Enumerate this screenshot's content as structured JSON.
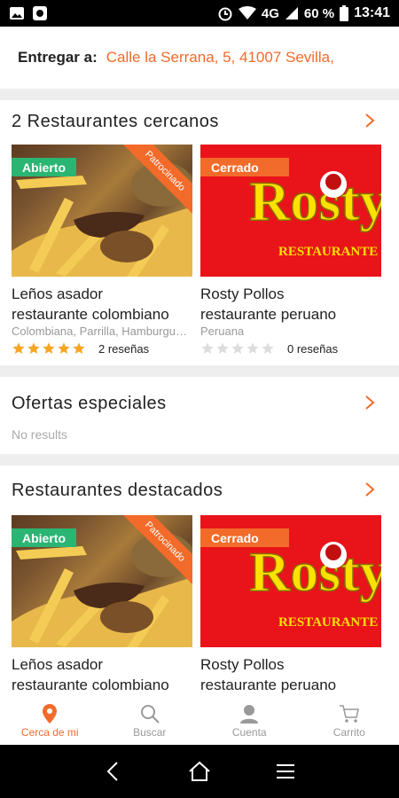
{
  "status_bar": {
    "network": "4G",
    "battery": "60 %",
    "time": "13:41"
  },
  "deliver": {
    "label": "Entregar a:",
    "address": "Calle la Serrana, 5, 41007 Sevilla,"
  },
  "nearby": {
    "title": "2 Restaurantes cercanos",
    "cards": [
      {
        "status": "Abierto",
        "sponsored": "Patrocinado",
        "name_line1": "Leños asador",
        "name_line2": "restaurante colombiano",
        "cuisine": "Colombiana, Parrilla, Hamburguesas",
        "stars": 5,
        "reviews": "2 reseñas"
      },
      {
        "status": "Cerrado",
        "logo_text": "Rosty",
        "logo_subtext": "RESTAURANTE P",
        "name_line1": "Rosty Pollos",
        "name_line2": "restaurante peruano",
        "cuisine": "Peruana",
        "stars": 0,
        "reviews": "0 reseñas"
      }
    ]
  },
  "offers": {
    "title": "Ofertas especiales",
    "empty_text": "No results"
  },
  "featured": {
    "title": "Restaurantes destacados",
    "cards": [
      {
        "status": "Abierto",
        "sponsored": "Patrocinado",
        "name_line1": "Leños asador",
        "name_line2": "restaurante colombiano"
      },
      {
        "status": "Cerrado",
        "logo_text": "Rosty",
        "logo_subtext": "RESTAURANTE P",
        "name_line1": "Rosty Pollos",
        "name_line2": "restaurante peruano"
      }
    ]
  },
  "bottom_nav": [
    {
      "label": "Cerca de mi",
      "icon": "location-pin-icon",
      "active": true
    },
    {
      "label": "Buscar",
      "icon": "search-icon",
      "active": false
    },
    {
      "label": "Cuenta",
      "icon": "account-icon",
      "active": false
    },
    {
      "label": "Carrito",
      "icon": "cart-icon",
      "active": false
    }
  ],
  "colors": {
    "accent": "#f26b2a",
    "open": "#2ab573",
    "star": "#f5a623",
    "star_empty": "#dddddd",
    "logo_red": "#e9141a",
    "logo_yellow": "#ffe100"
  }
}
